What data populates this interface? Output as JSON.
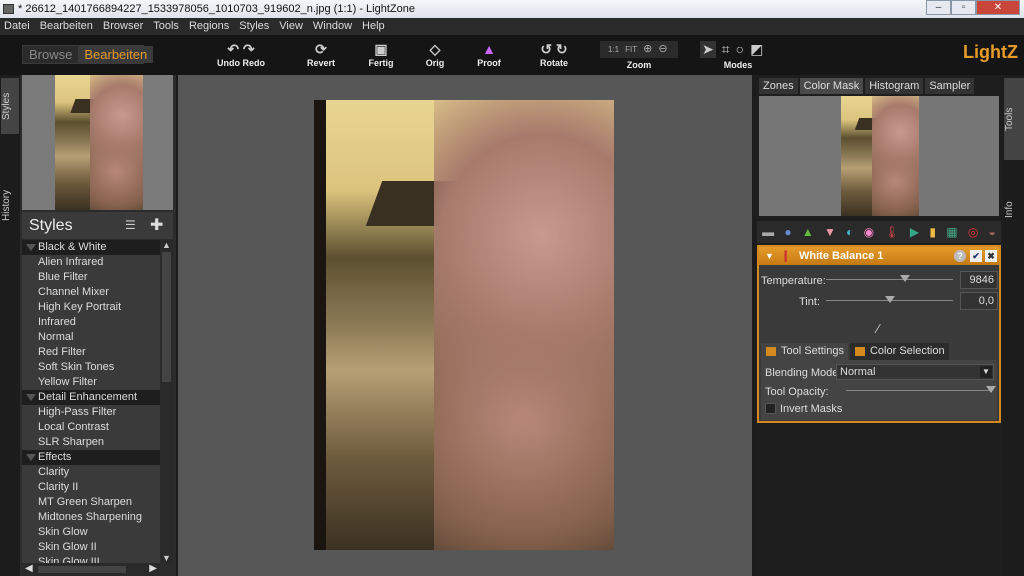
{
  "window": {
    "title": "* 26612_1401766894227_1533978056_1010703_919602_n.jpg (1:1) - LightZone"
  },
  "menu": [
    "Datei",
    "Bearbeiten",
    "Browser",
    "Tools",
    "Regions",
    "Styles",
    "View",
    "Window",
    "Help"
  ],
  "modes": {
    "browse": "Browse",
    "edit": "Bearbeiten"
  },
  "toolbar": {
    "undo_redo": "Undo Redo",
    "revert": "Revert",
    "done": "Fertig",
    "orig": "Orig",
    "proof": "Proof",
    "rotate": "Rotate",
    "zoom": "Zoom",
    "zoom_fit": "FIT",
    "modes": "Modes"
  },
  "brand": "LightZ",
  "left_tabs": {
    "styles": "Styles",
    "history": "History"
  },
  "right_tabs": {
    "tools": "Tools",
    "info": "Info"
  },
  "styles": {
    "title": "Styles",
    "categories": [
      {
        "name": "Black & White",
        "items": [
          "Alien Infrared",
          "Blue Filter",
          "Channel Mixer",
          "High Key Portrait",
          "Infrared",
          "Normal",
          "Red Filter",
          "Soft Skin Tones",
          "Yellow Filter"
        ]
      },
      {
        "name": "Detail Enhancement",
        "items": [
          "High-Pass Filter",
          "Local Contrast",
          "SLR Sharpen"
        ]
      },
      {
        "name": "Effects",
        "items": [
          "Clarity",
          "Clarity II",
          "MT Green Sharpen",
          "Midtones Sharpening",
          "Skin Glow",
          "Skin Glow II",
          "Skin Glow III"
        ]
      }
    ]
  },
  "panel_tabs": [
    {
      "label": "Zones",
      "active": false
    },
    {
      "label": "Color Mask",
      "active": true
    },
    {
      "label": "Histogram",
      "active": false
    },
    {
      "label": "Sampler",
      "active": false
    }
  ],
  "tool": {
    "title": "White Balance 1",
    "temperature_label": "Temperature:",
    "temperature": "9846",
    "temperature_pos": 0.62,
    "tint_label": "Tint:",
    "tint": "0,0",
    "tint_pos": 0.5,
    "tabs": [
      "Tool Settings",
      "Color Selection"
    ],
    "blending_label": "Blending Mode:",
    "blending": "Normal",
    "opacity_label": "Tool Opacity:",
    "opacity": 1.0,
    "invert_label": "Invert Masks",
    "invert": false
  },
  "colors": {
    "accent": "#e59a2a"
  }
}
